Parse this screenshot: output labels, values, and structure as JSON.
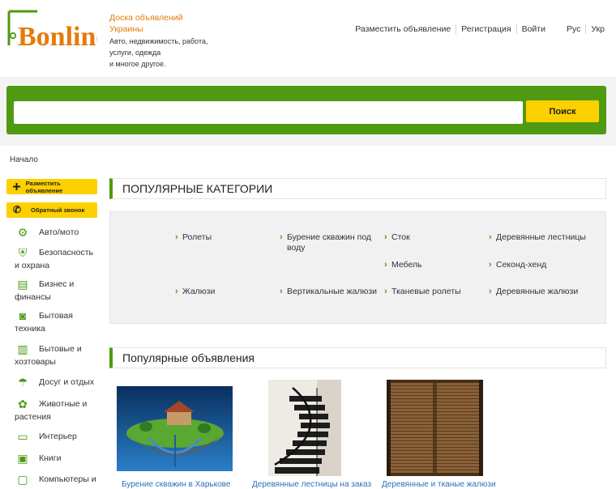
{
  "brand": {
    "logo_text": "Bonline"
  },
  "tagline": {
    "line1": "Доска объявлений",
    "line2": "Украины",
    "desc1": "Авто, недвижимость, работа,",
    "desc2": "услуги, одежда",
    "desc3": "и многое другое."
  },
  "topnav": {
    "post_ad": "Разместить объявление",
    "register": "Регистрация",
    "login": "Войти",
    "lang_ru": "Рус",
    "lang_uk": "Укр"
  },
  "search": {
    "value": "",
    "button_label": "Поиск"
  },
  "breadcrumb": "Начало",
  "sidebar": {
    "post_ad_label": "Разместить объявление",
    "callback_label": "Обратный звонок",
    "categories": [
      {
        "label": "Авто/мото",
        "icon": "car-icon"
      },
      {
        "label": "Безопасность и охрана",
        "icon": "shield-icon"
      },
      {
        "label": "Бизнес и финансы",
        "icon": "money-icon"
      },
      {
        "label": "Бытовая техника",
        "icon": "washer-icon"
      },
      {
        "label": "Бытовые и хозтовары",
        "icon": "bucket-icon"
      },
      {
        "label": "Досуг и отдых",
        "icon": "leisure-icon"
      },
      {
        "label": "Животные и растения",
        "icon": "paw-icon"
      },
      {
        "label": "Интерьер",
        "icon": "sofa-icon"
      },
      {
        "label": "Книги",
        "icon": "book-icon"
      },
      {
        "label": "Компьютеры и",
        "icon": "computer-icon"
      }
    ]
  },
  "popular_categories": {
    "heading": "ПОПУЛЯРНЫЕ КАТЕГОРИИ",
    "items": [
      "Ролеты",
      "Бурение скважин под воду",
      "Сток",
      "Деревянные лестницы",
      "Мебель",
      "Секонд-хенд",
      "Жалюзи",
      "Вертикальные жалюзи",
      "Тканевые ролеты",
      "Деревянные жалюзи"
    ]
  },
  "popular_ads": {
    "heading": "Популярные объявления",
    "items": [
      {
        "title": "Бурение скважин в Харькове"
      },
      {
        "title": "Деревянные лестницы на заказ"
      },
      {
        "title": "Деревянные и тканые жалюзи"
      }
    ]
  },
  "colors": {
    "accent_green": "#4f9a12",
    "accent_yellow": "#fdd000",
    "accent_orange": "#e57a0c"
  }
}
